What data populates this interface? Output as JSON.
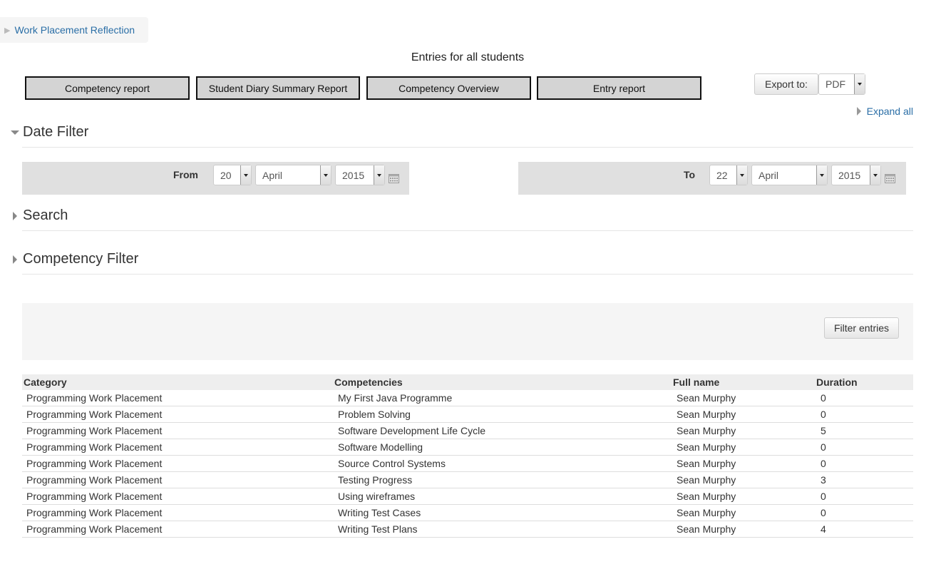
{
  "breadcrumb": {
    "label": "Work Placement Reflection"
  },
  "page_title": "Entries for all students",
  "report_buttons": [
    "Competency report",
    "Student Diary Summary Report",
    "Competency Overview",
    "Entry report"
  ],
  "export": {
    "label": "Export to:",
    "format": "PDF"
  },
  "expand_all": "Expand all",
  "sections": {
    "date_filter": "Date Filter",
    "search": "Search",
    "competency_filter": "Competency Filter"
  },
  "date_from": {
    "label": "From",
    "day": "20",
    "month": "April",
    "year": "2015"
  },
  "date_to": {
    "label": "To",
    "day": "22",
    "month": "April",
    "year": "2015"
  },
  "filter_button": "Filter entries",
  "table": {
    "headers": [
      "Category",
      "Competencies",
      "Full name",
      "Duration"
    ],
    "rows": [
      [
        "Programming Work Placement",
        "My First Java Programme",
        "Sean Murphy",
        "0"
      ],
      [
        "Programming Work Placement",
        "Problem Solving",
        "Sean Murphy",
        "0"
      ],
      [
        "Programming Work Placement",
        "Software Development Life Cycle",
        "Sean Murphy",
        "5"
      ],
      [
        "Programming Work Placement",
        "Software Modelling",
        "Sean Murphy",
        "0"
      ],
      [
        "Programming Work Placement",
        "Source Control Systems",
        "Sean Murphy",
        "0"
      ],
      [
        "Programming Work Placement",
        "Testing Progress",
        "Sean Murphy",
        "3"
      ],
      [
        "Programming Work Placement",
        "Using wireframes",
        "Sean Murphy",
        "0"
      ],
      [
        "Programming Work Placement",
        "Writing Test Cases",
        "Sean Murphy",
        "0"
      ],
      [
        "Programming Work Placement",
        "Writing Test Plans",
        "Sean Murphy",
        "4"
      ]
    ]
  },
  "colors": {
    "link": "#2a6ea6",
    "report_button_bg": "#d4d4d4",
    "date_box_bg": "#e0e0e0",
    "filter_panel_bg": "#f5f5f5"
  }
}
